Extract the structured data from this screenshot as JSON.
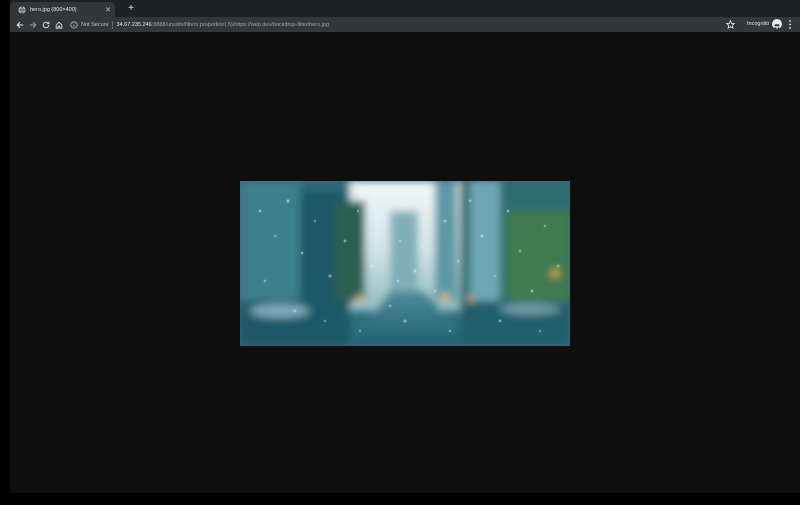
{
  "tab": {
    "title": "hero.jpg (800×400)",
    "favicon": "globe-icon",
    "close_icon": "close-icon"
  },
  "new_tab_label": "+",
  "toolbar": {
    "back_icon": "back-arrow-icon",
    "forward_icon": "forward-arrow-icon",
    "reload_icon": "reload-icon",
    "home_icon": "home-icon"
  },
  "omnibox": {
    "security_label": "Not Secure",
    "url_host": "34.67.235.246",
    "url_rest": ":8888/unsafe/filters:proportion(.5)/https://web.dev/backdrop-filter/hero.jpg",
    "star_icon": "star-icon"
  },
  "profile": {
    "label": "Incognito",
    "avatar_icon": "incognito-avatar-icon"
  },
  "menu_icon": "vertical-dots-menu-icon",
  "image": {
    "description_icon": "rain-window-city-image",
    "colors": {
      "page_bg": "#0e0e0e",
      "chrome_dark": "#1f2023",
      "toolbar": "#35363a",
      "sky": "#e9f1f2",
      "teal": "#2f7a8a"
    }
  }
}
